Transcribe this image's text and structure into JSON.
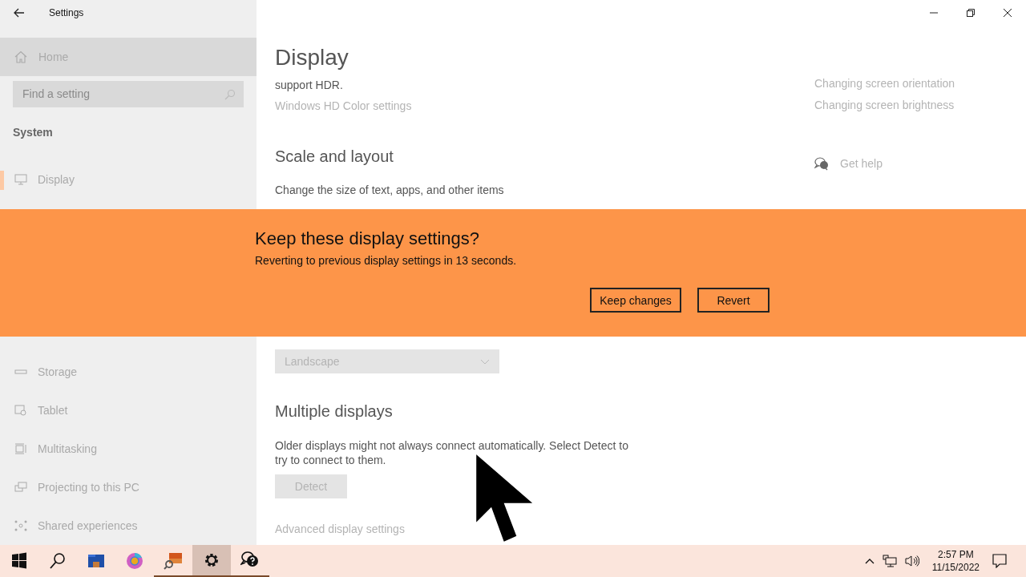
{
  "window": {
    "title": "Settings"
  },
  "sidebar": {
    "home": "Home",
    "search": {
      "placeholder": "Find a setting"
    },
    "section": "System",
    "items": [
      {
        "label": "Display",
        "selected": true
      },
      {
        "label": "Storage",
        "selected": false
      },
      {
        "label": "Tablet",
        "selected": false
      },
      {
        "label": "Multitasking",
        "selected": false
      },
      {
        "label": "Projecting to this PC",
        "selected": false
      },
      {
        "label": "Shared experiences",
        "selected": false
      }
    ]
  },
  "page": {
    "title": "Display",
    "hdr_text": "support HDR.",
    "hdr_link": "Windows HD Color settings",
    "scale_heading": "Scale and layout",
    "scale_label": "Change the size of text, apps, and other items",
    "orientation_value": "Landscape",
    "multi_heading": "Multiple displays",
    "multi_text": "Older displays might not always connect automatically. Select Detect to try to connect to them.",
    "detect_button": "Detect",
    "advanced_link": "Advanced display settings"
  },
  "related": {
    "links": [
      "Changing screen orientation",
      "Changing screen brightness"
    ],
    "help": "Get help"
  },
  "dialog": {
    "title": "Keep these display settings?",
    "message": "Reverting to previous display settings in 13 seconds.",
    "buttons": [
      "Keep changes",
      "Revert"
    ]
  },
  "taskbar": {
    "apps": [
      {
        "running": false,
        "selected": false
      },
      {
        "running": false,
        "selected": false
      },
      {
        "running": false,
        "selected": false
      },
      {
        "running": false,
        "selected": false
      },
      {
        "running": true,
        "selected": false
      },
      {
        "running": true,
        "selected": true
      },
      {
        "running": true,
        "selected": false
      }
    ],
    "time": "2:57 PM",
    "date": "11/15/2022"
  }
}
